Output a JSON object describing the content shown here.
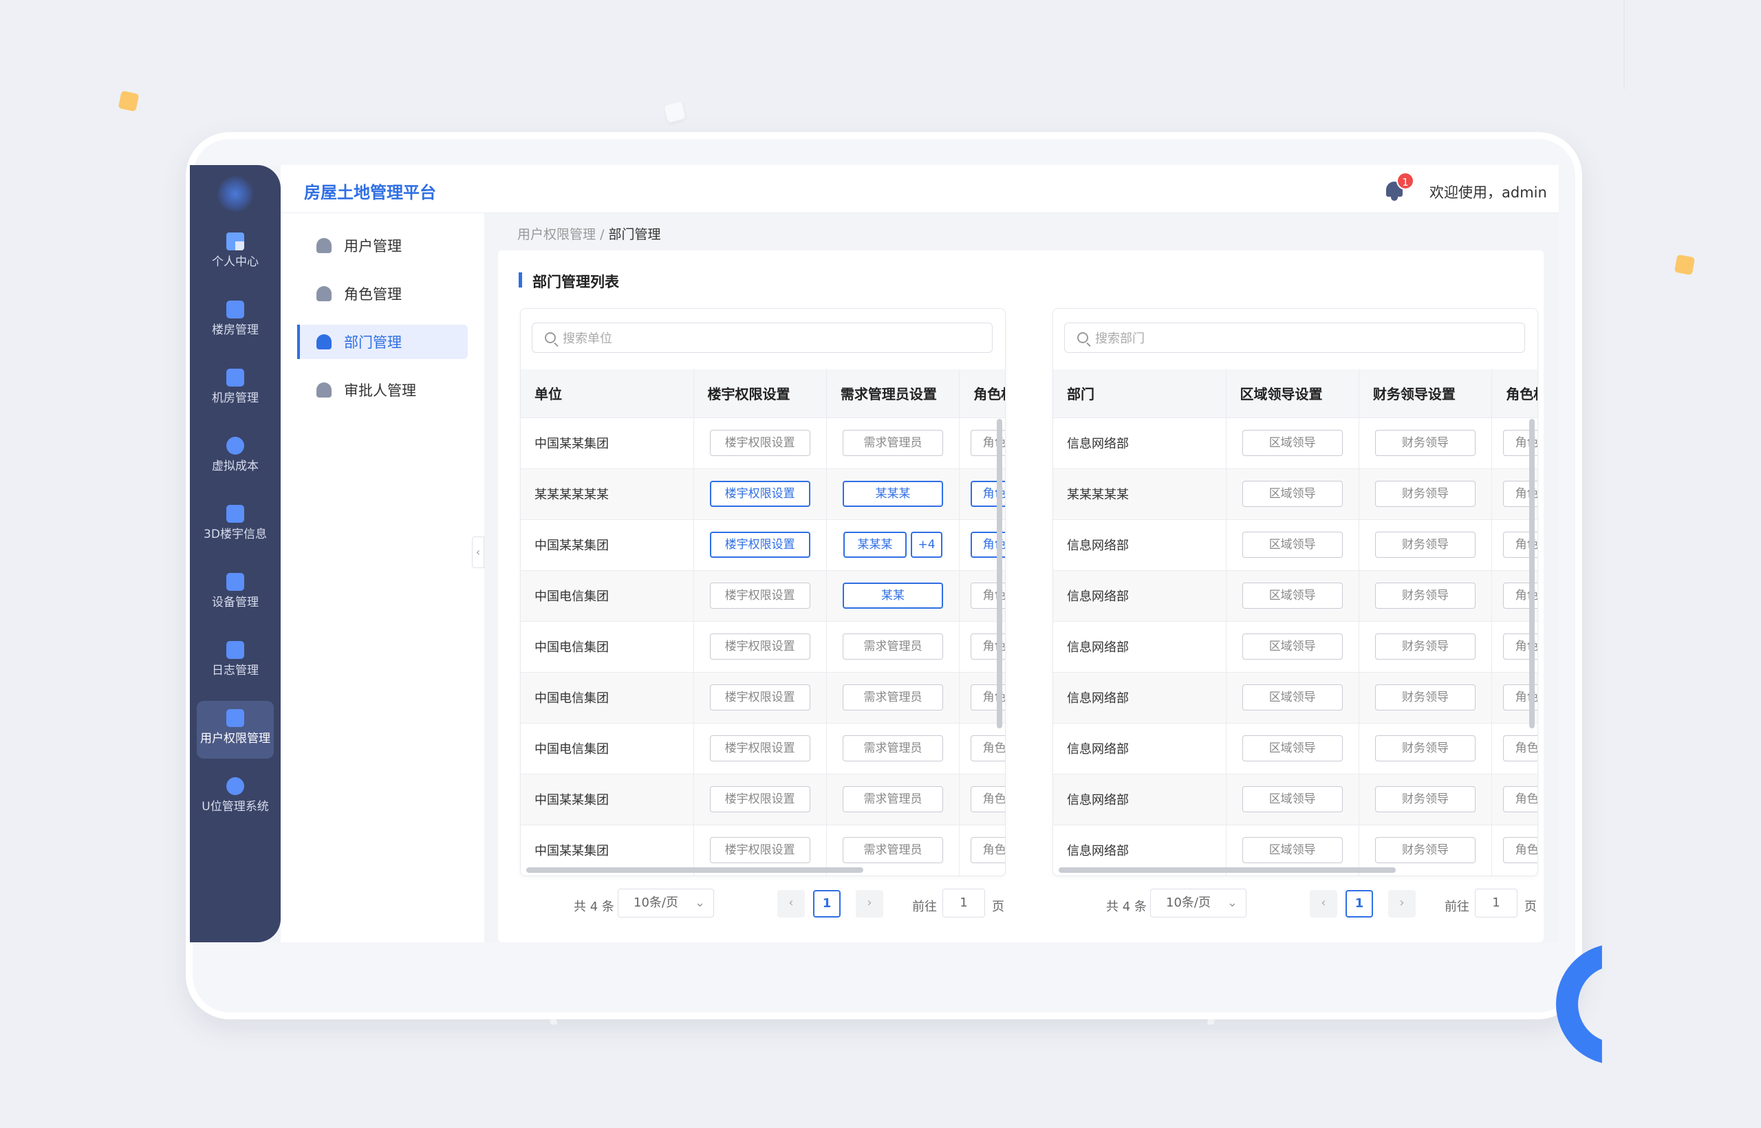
{
  "colors": {
    "accent": "#2f6fe4",
    "sidebar_bg": "#3a4467",
    "badge": "#f04a4a"
  },
  "app": {
    "title": "房屋土地管理平台"
  },
  "header": {
    "notification_count": "1",
    "welcome": "欢迎使用，admin"
  },
  "nav": [
    {
      "label": "个人中心",
      "icon": "dashboard-icon"
    },
    {
      "label": "楼房管理",
      "icon": "building-icon"
    },
    {
      "label": "机房管理",
      "icon": "server-room-icon"
    },
    {
      "label": "虚拟成本",
      "icon": "cost-icon"
    },
    {
      "label": "3D楼宇信息",
      "icon": "cube-icon"
    },
    {
      "label": "设备管理",
      "icon": "equipment-icon"
    },
    {
      "label": "日志管理",
      "icon": "log-icon"
    },
    {
      "label": "用户权限管理",
      "icon": "user-permission-icon",
      "active": true
    },
    {
      "label": "U位管理系统",
      "icon": "u-position-icon"
    }
  ],
  "submenu": [
    {
      "label": "用户管理",
      "icon": "user-icon"
    },
    {
      "label": "角色管理",
      "icon": "role-icon"
    },
    {
      "label": "部门管理",
      "icon": "department-icon",
      "active": true
    },
    {
      "label": "审批人管理",
      "icon": "approver-icon"
    }
  ],
  "breadcrumb": {
    "parent": "用户权限管理",
    "separator": "/",
    "current": "部门管理"
  },
  "card": {
    "title": "部门管理列表"
  },
  "left_panel": {
    "search_placeholder": "搜索单位",
    "columns": [
      "单位",
      "楼宇权限设置",
      "需求管理员设置",
      "角色权"
    ],
    "rows": [
      {
        "unit": "中国某某集团",
        "building": "楼宇权限设置",
        "building_active": false,
        "admin": "需求管理员",
        "admin_active": false,
        "role": "角色"
      },
      {
        "unit": "某某某某某某",
        "building": "楼宇权限设置",
        "building_active": true,
        "admin": "某某某",
        "admin_active": true,
        "role": "角色"
      },
      {
        "unit": "中国某某集团",
        "building": "楼宇权限设置",
        "building_active": true,
        "admin": "某某某",
        "admin_active": true,
        "admin_extra": "+4",
        "role": "角色"
      },
      {
        "unit": "中国电信集团",
        "building": "楼宇权限设置",
        "building_active": false,
        "admin": "某某",
        "admin_active": true,
        "role": "角色"
      },
      {
        "unit": "中国电信集团",
        "building": "楼宇权限设置",
        "building_active": false,
        "admin": "需求管理员",
        "admin_active": false,
        "role": "角色"
      },
      {
        "unit": "中国电信集团",
        "building": "楼宇权限设置",
        "building_active": false,
        "admin": "需求管理员",
        "admin_active": false,
        "role": "角色"
      },
      {
        "unit": "中国电信集团",
        "building": "楼宇权限设置",
        "building_active": false,
        "admin": "需求管理员",
        "admin_active": false,
        "role": "角色"
      },
      {
        "unit": "中国某某集团",
        "building": "楼宇权限设置",
        "building_active": false,
        "admin": "需求管理员",
        "admin_active": false,
        "role": "角色"
      },
      {
        "unit": "中国某某集团",
        "building": "楼宇权限设置",
        "building_active": false,
        "admin": "需求管理员",
        "admin_active": false,
        "role": "角色"
      }
    ],
    "pager": {
      "total": "共 4 条",
      "size": "10条/页",
      "current": "1",
      "goto": "前往",
      "goto_value": "1",
      "page": "页"
    }
  },
  "right_panel": {
    "search_placeholder": "搜索部门",
    "columns": [
      "部门",
      "区域领导设置",
      "财务领导设置",
      "角色权"
    ],
    "rows": [
      {
        "dept": "信息网络部",
        "region": "区域领导",
        "finance": "财务领导",
        "role": "角色"
      },
      {
        "dept": "某某某某某",
        "region": "区域领导",
        "finance": "财务领导",
        "role": "角色"
      },
      {
        "dept": "信息网络部",
        "region": "区域领导",
        "finance": "财务领导",
        "role": "角色"
      },
      {
        "dept": "信息网络部",
        "region": "区域领导",
        "finance": "财务领导",
        "role": "角色"
      },
      {
        "dept": "信息网络部",
        "region": "区域领导",
        "finance": "财务领导",
        "role": "角色"
      },
      {
        "dept": "信息网络部",
        "region": "区域领导",
        "finance": "财务领导",
        "role": "角色"
      },
      {
        "dept": "信息网络部",
        "region": "区域领导",
        "finance": "财务领导",
        "role": "角色"
      },
      {
        "dept": "信息网络部",
        "region": "区域领导",
        "finance": "财务领导",
        "role": "角色"
      },
      {
        "dept": "信息网络部",
        "region": "区域领导",
        "finance": "财务领导",
        "role": "角色"
      }
    ],
    "pager": {
      "total": "共 4 条",
      "size": "10条/页",
      "current": "1",
      "goto": "前往",
      "goto_value": "1",
      "page": "页"
    }
  }
}
